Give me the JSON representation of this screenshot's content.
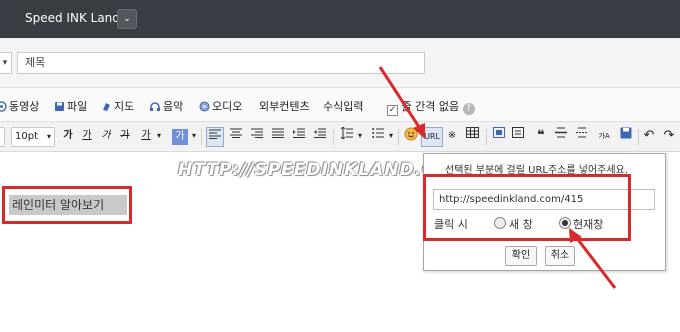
{
  "blog": {
    "title": "Speed INK Land",
    "dropdown": "⌄"
  },
  "subject": {
    "category_arrow": "▾",
    "placeholder": "제목"
  },
  "attach": {
    "video": "동영상",
    "file": "파일",
    "map": "지도",
    "music": "음악",
    "audio": "오디오",
    "external": "외부컨텐츠",
    "formula": "수식입력",
    "no_line_space": "줄 간격 없음"
  },
  "toolbar": {
    "font_size": "10pt",
    "bold": "가",
    "underline": "가",
    "italic": "가",
    "strike": "가",
    "font_color": "가",
    "bg_color": "가",
    "url_button": "URL",
    "quote": "❝"
  },
  "content": {
    "selected_text": "레인미터 알아보기",
    "watermark": "HTTP://SPEEDINKLAND.COM"
  },
  "url_popup": {
    "message": "선택된 부분에 걸릴 URL주소를 넣어주세요.",
    "url_value": "http://speedinkland.com/415",
    "click_label": "클릭 시",
    "new_window": "새 창",
    "current_window": "현재창",
    "confirm": "확인",
    "cancel": "취소"
  },
  "colors": {
    "highlight_red": "#d9292b",
    "topbar": "#3a3d43"
  }
}
